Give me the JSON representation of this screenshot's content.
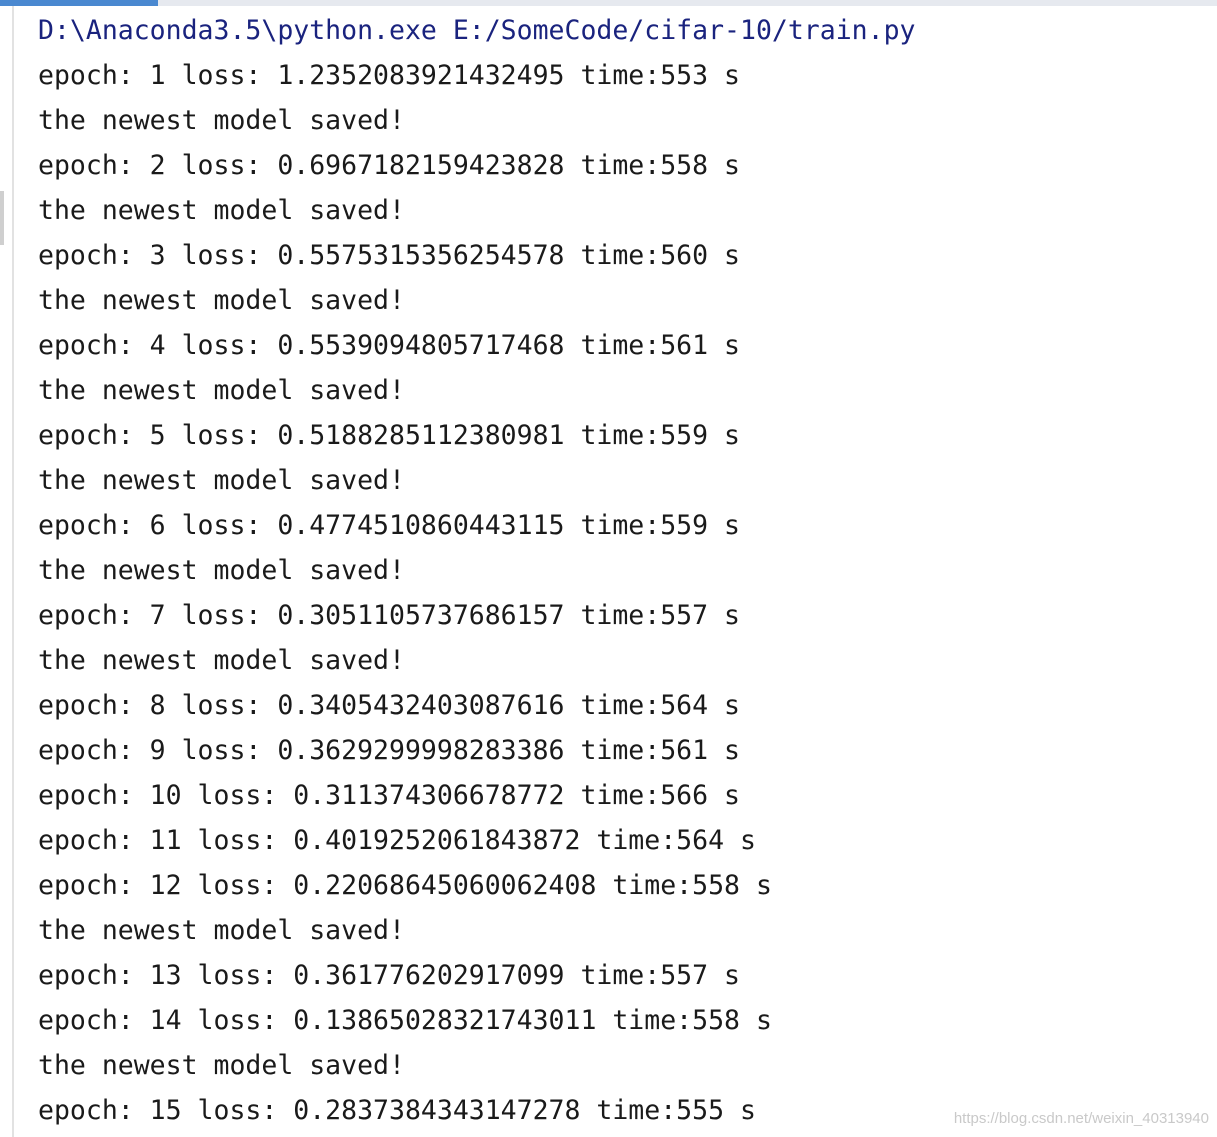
{
  "command": "D:\\Anaconda3.5\\python.exe E:/SomeCode/cifar-10/train.py",
  "output_lines": [
    "epoch: 1 loss: 1.2352083921432495 time:553 s",
    "the newest model saved!",
    "epoch: 2 loss: 0.6967182159423828 time:558 s",
    "the newest model saved!",
    "epoch: 3 loss: 0.5575315356254578 time:560 s",
    "the newest model saved!",
    "epoch: 4 loss: 0.5539094805717468 time:561 s",
    "the newest model saved!",
    "epoch: 5 loss: 0.5188285112380981 time:559 s",
    "the newest model saved!",
    "epoch: 6 loss: 0.4774510860443115 time:559 s",
    "the newest model saved!",
    "epoch: 7 loss: 0.3051105737686157 time:557 s",
    "the newest model saved!",
    "epoch: 8 loss: 0.3405432403087616 time:564 s",
    "epoch: 9 loss: 0.3629299998283386 time:561 s",
    "epoch: 10 loss: 0.311374306678772 time:566 s",
    "epoch: 11 loss: 0.4019252061843872 time:564 s",
    "epoch: 12 loss: 0.22068645060062408 time:558 s",
    "the newest model saved!",
    "epoch: 13 loss: 0.361776202917099 time:557 s",
    "epoch: 14 loss: 0.13865028321743011 time:558 s",
    "the newest model saved!",
    "epoch: 15 loss: 0.2837384343147278 time:555 s"
  ],
  "watermark": "https://blog.csdn.net/weixin_40313940",
  "colors": {
    "command": "#1a237e",
    "output": "#1a1a1a",
    "active_tab": "#4a88d0"
  }
}
